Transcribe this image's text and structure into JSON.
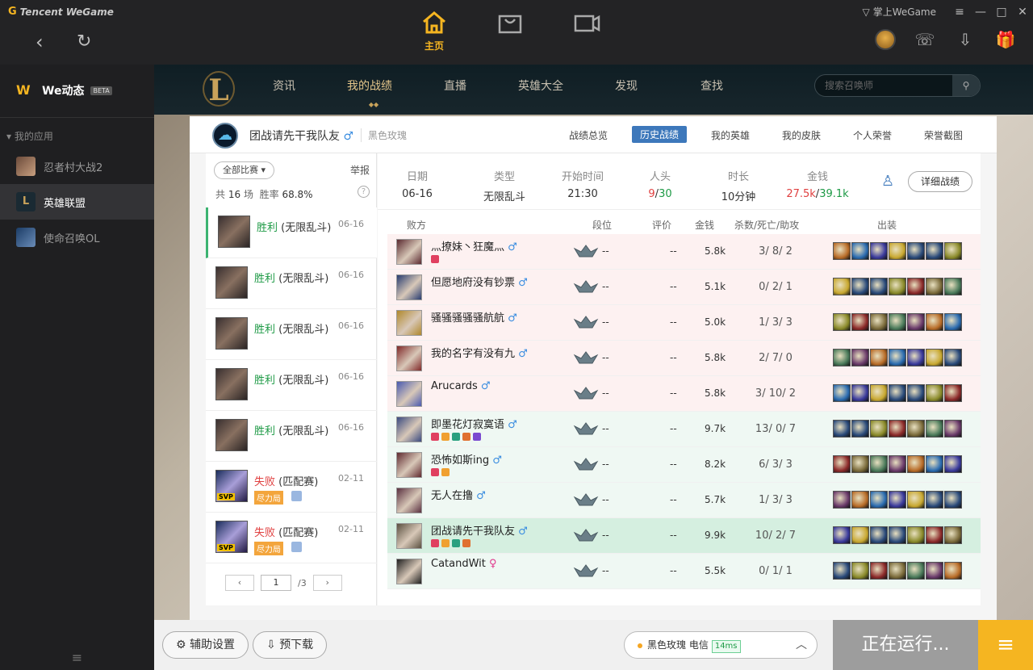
{
  "brand": "Tencent WeGame",
  "topbar": {
    "home_label": "主页",
    "phone_label": "掌上WeGame"
  },
  "sidebar": {
    "we_title": "We动态",
    "beta": "BETA",
    "my_apps": "我的应用",
    "apps": [
      {
        "label": "忍者村大战2"
      },
      {
        "label": "英雄联盟"
      },
      {
        "label": "使命召唤OL"
      }
    ]
  },
  "game_nav": {
    "tabs": [
      "资讯",
      "我的战绩",
      "直播",
      "英雄大全",
      "发现",
      "查找"
    ],
    "search_placeholder": "搜索召唤师"
  },
  "profile": {
    "name": "团战请先干我队友",
    "gender": "♂",
    "server": "黑色玫瑰",
    "tabs": [
      "战绩总览",
      "历史战绩",
      "我的英雄",
      "我的皮肤",
      "个人荣誉",
      "荣誉截图"
    ]
  },
  "match_list": {
    "filter": "全部比赛",
    "report": "举报",
    "stats_prefix": "共",
    "count": "16",
    "stats_mid": "场",
    "winrate_label": "胜率",
    "winrate": "68.8%",
    "help": "?",
    "matches": [
      {
        "result": "胜利",
        "type": "(无限乱斗)",
        "date": "06-16"
      },
      {
        "result": "胜利",
        "type": "(无限乱斗)",
        "date": "06-16"
      },
      {
        "result": "胜利",
        "type": "(无限乱斗)",
        "date": "06-16"
      },
      {
        "result": "胜利",
        "type": "(无限乱斗)",
        "date": "06-16"
      },
      {
        "result": "胜利",
        "type": "(无限乱斗)",
        "date": "06-16"
      },
      {
        "result": "失败",
        "type": "(匹配赛)",
        "date": "02-11",
        "tag": "尽力局",
        "svp": "SVP"
      },
      {
        "result": "失败",
        "type": "(匹配赛)",
        "date": "02-11",
        "tag": "尽力局",
        "svp": "SVP"
      }
    ],
    "page": "1",
    "pages": "/3"
  },
  "summary": {
    "date_label": "日期",
    "date": "06-16",
    "type_label": "类型",
    "type": "无限乱斗",
    "start_label": "开始时间",
    "start": "21:30",
    "kills_label": "人头",
    "kills_a": "9",
    "kills_b": "30",
    "duration_label": "时长",
    "duration": "10分钟",
    "gold_label": "金钱",
    "gold_a": "27.5k",
    "gold_b": "39.1k",
    "detail_button": "详细战绩"
  },
  "table": {
    "headers": [
      "败方",
      "段位",
      "评价",
      "金钱",
      "杀数/死亡/助攻",
      "出装"
    ],
    "players": [
      {
        "name": "灬撩妹丶狂魔灬",
        "gender": "♂",
        "rank": "--",
        "eval": "--",
        "gold": "5.8k",
        "k": "3",
        "d": "8",
        "a": "2"
      },
      {
        "name": "但愿地府没有钞票",
        "gender": "♂",
        "rank": "--",
        "eval": "--",
        "gold": "5.1k",
        "k": "0",
        "d": "2",
        "a": "1"
      },
      {
        "name": "骚骚骚骚骚航航",
        "gender": "♂",
        "rank": "--",
        "eval": "--",
        "gold": "5.0k",
        "k": "1",
        "d": "3",
        "a": "3"
      },
      {
        "name": "我的名字有没有九",
        "gender": "♂",
        "rank": "--",
        "eval": "--",
        "gold": "5.8k",
        "k": "2",
        "d": "7",
        "a": "0"
      },
      {
        "name": "Arucards",
        "gender": "♂",
        "rank": "--",
        "eval": "--",
        "gold": "5.8k",
        "k": "3",
        "d": "10",
        "a": "2"
      },
      {
        "name": "即墨花灯寂寞语",
        "gender": "♂",
        "rank": "--",
        "eval": "--",
        "gold": "9.7k",
        "k": "13",
        "d": "0",
        "a": "7"
      },
      {
        "name": "恐怖如斯ing",
        "gender": "♂",
        "rank": "--",
        "eval": "--",
        "gold": "8.2k",
        "k": "6",
        "d": "3",
        "a": "3"
      },
      {
        "name": "无人在撸",
        "gender": "♂",
        "rank": "--",
        "eval": "--",
        "gold": "5.7k",
        "k": "1",
        "d": "3",
        "a": "3"
      },
      {
        "name": "团战请先干我队友",
        "gender": "♂",
        "rank": "--",
        "eval": "--",
        "gold": "9.9k",
        "k": "10",
        "d": "2",
        "a": "7"
      },
      {
        "name": "CatandWit",
        "gender": "♀",
        "rank": "--",
        "eval": "--",
        "gold": "5.5k",
        "k": "0",
        "d": "1",
        "a": "1"
      }
    ]
  },
  "bottom": {
    "assist_settings": "辅助设置",
    "predownload": "预下载",
    "server": "黑色玫瑰 电信",
    "ping": "14ms",
    "running": "正在运行..."
  }
}
